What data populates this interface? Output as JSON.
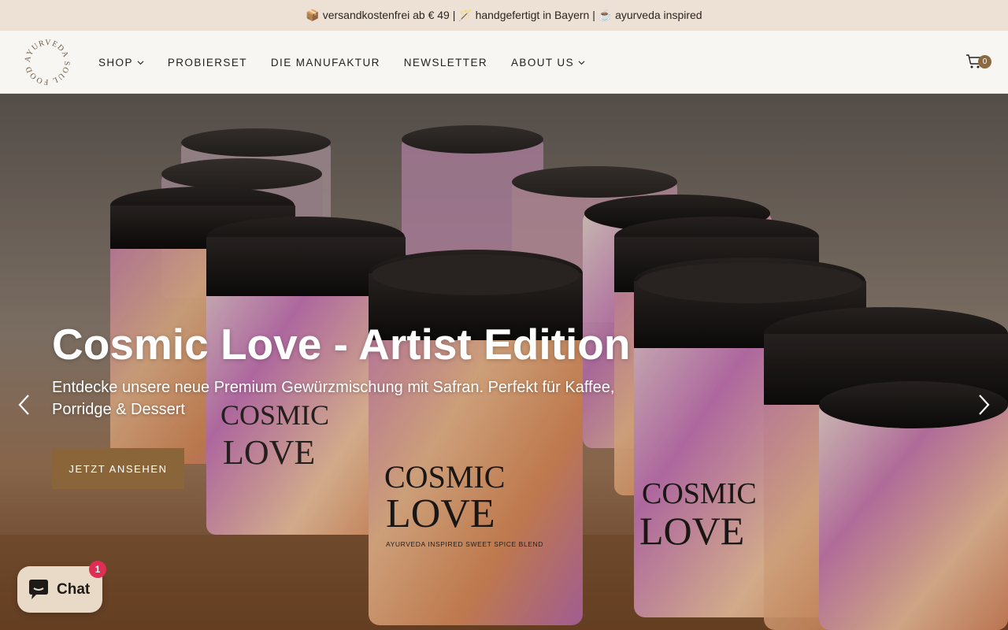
{
  "announcement": {
    "text": "📦 versandkostenfrei ab € 49 | 🪄 handgefertigt in Bayern | ☕ ayurveda inspired"
  },
  "header": {
    "logo_text": "AYURVEDA SOUL FOOD",
    "nav": [
      {
        "label": "SHOP",
        "has_dropdown": true
      },
      {
        "label": "PROBIERSET",
        "has_dropdown": false
      },
      {
        "label": "DIE MANUFAKTUR",
        "has_dropdown": false
      },
      {
        "label": "NEWSLETTER",
        "has_dropdown": false
      },
      {
        "label": "ABOUT US",
        "has_dropdown": true
      }
    ],
    "cart_count": "0",
    "cart_icon": "cart-icon"
  },
  "hero": {
    "title": "Cosmic Love - Artist Edition",
    "subtitle": "Entdecke unsere neue Premium Gewürzmischung mit Safran. Perfekt für Kaffee, Porridge & Dessert",
    "button_label": "JETZT ANSEHEN",
    "jar_label_1": "COSMIC",
    "jar_label_2": "LOVE",
    "jar_small": "AYURVEDA INSPIRED SWEET SPICE BLEND"
  },
  "chat": {
    "label": "Chat",
    "badge": "1"
  },
  "colors": {
    "announcement_bg": "#ede0d5",
    "accent": "#8a6539",
    "badge_red": "#e02d53"
  }
}
